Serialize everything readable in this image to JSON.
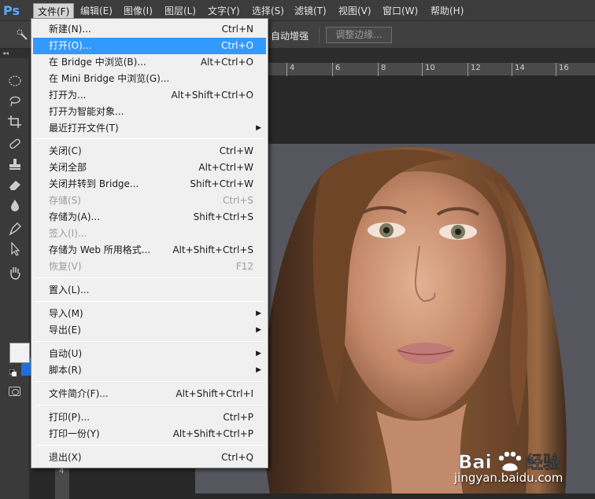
{
  "app": {
    "logo": "Ps"
  },
  "menubar": {
    "items": [
      {
        "label": "文件(F)"
      },
      {
        "label": "编辑(E)"
      },
      {
        "label": "图像(I)"
      },
      {
        "label": "图层(L)"
      },
      {
        "label": "文字(Y)"
      },
      {
        "label": "选择(S)"
      },
      {
        "label": "滤镜(T)"
      },
      {
        "label": "视图(V)"
      },
      {
        "label": "窗口(W)"
      },
      {
        "label": "帮助(H)"
      }
    ]
  },
  "options_bar": {
    "auto_enhance_label": "自动增强",
    "refine_edge_label": "调整边缘..."
  },
  "ruler": {
    "h_labels": [
      "4",
      "6",
      "8",
      "10",
      "12",
      "14",
      "16"
    ],
    "v_label": "4"
  },
  "file_menu": {
    "items": [
      {
        "label": "新建(N)...",
        "shortcut": "Ctrl+N"
      },
      {
        "label": "打开(O)...",
        "shortcut": "Ctrl+O",
        "highlighted": true
      },
      {
        "label": "在 Bridge 中浏览(B)...",
        "shortcut": "Alt+Ctrl+O"
      },
      {
        "label": "在 Mini Bridge 中浏览(G)...",
        "shortcut": ""
      },
      {
        "label": "打开为...",
        "shortcut": "Alt+Shift+Ctrl+O"
      },
      {
        "label": "打开为智能对象...",
        "shortcut": ""
      },
      {
        "label": "最近打开文件(T)",
        "shortcut": "",
        "submenu": true
      },
      {
        "label": "关闭(C)",
        "shortcut": "Ctrl+W"
      },
      {
        "label": "关闭全部",
        "shortcut": "Alt+Ctrl+W"
      },
      {
        "label": "关闭并转到 Bridge...",
        "shortcut": "Shift+Ctrl+W"
      },
      {
        "label": "存储(S)",
        "shortcut": "Ctrl+S",
        "disabled": true
      },
      {
        "label": "存储为(A)...",
        "shortcut": "Shift+Ctrl+S"
      },
      {
        "label": "签入(I)...",
        "shortcut": "",
        "disabled": true
      },
      {
        "label": "存储为 Web 所用格式...",
        "shortcut": "Alt+Shift+Ctrl+S"
      },
      {
        "label": "恢复(V)",
        "shortcut": "F12",
        "disabled": true
      },
      {
        "label": "置入(L)...",
        "shortcut": ""
      },
      {
        "label": "导入(M)",
        "shortcut": "",
        "submenu": true
      },
      {
        "label": "导出(E)",
        "shortcut": "",
        "submenu": true
      },
      {
        "label": "自动(U)",
        "shortcut": "",
        "submenu": true
      },
      {
        "label": "脚本(R)",
        "shortcut": "",
        "submenu": true
      },
      {
        "label": "文件简介(F)...",
        "shortcut": "Alt+Shift+Ctrl+I"
      },
      {
        "label": "打印(P)...",
        "shortcut": "Ctrl+P"
      },
      {
        "label": "打印一份(Y)",
        "shortcut": "Alt+Shift+Ctrl+P"
      },
      {
        "label": "退出(X)",
        "shortcut": "Ctrl+Q"
      }
    ],
    "submenu_arrow": "▶"
  },
  "watermark": {
    "brand": "Bai",
    "brand2": "经验",
    "url": "jingyan.baidu.com"
  },
  "colors": {
    "foreground": "#f2f2f2",
    "background": "#1e6fe0",
    "highlight": "#3399ff"
  }
}
